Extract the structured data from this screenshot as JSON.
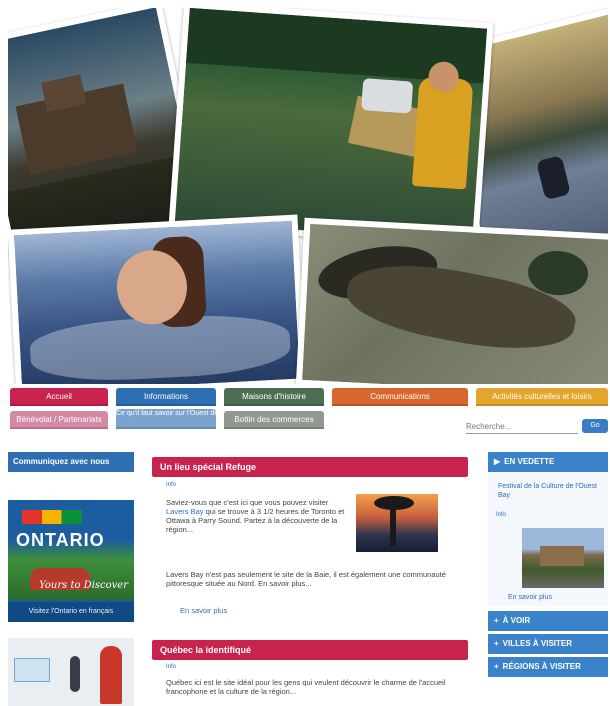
{
  "nav": {
    "row1": [
      {
        "label": "Accueil",
        "color": "#c8234d"
      },
      {
        "label": "Informations",
        "color": "#2d6fb2"
      },
      {
        "label": "Maisons d'histoire",
        "color": "#4e6e54"
      },
      {
        "label": "Communications",
        "color": "#d9662c"
      },
      {
        "label": "Activités culturelles et loisirs",
        "color": "#e3a52b"
      }
    ],
    "row2": [
      {
        "label": "Bénévolat / Partenariats",
        "color": "#d48aa4"
      },
      {
        "label": "Ce qu'il faut savoir sur l'Ouest de l'Ontario",
        "color": "#7aa4cf"
      },
      {
        "label": "Bottin des commerces",
        "color": "#8e9a8f"
      }
    ]
  },
  "search": {
    "placeholder": "Recherche...",
    "button": "Go"
  },
  "left": {
    "header": "Communiquez avec nous",
    "ad_logo": "ONTARIO",
    "ad_script": "Yours to Discover",
    "ad_caption": "Visitez l'Ontario en français"
  },
  "main": {
    "section1": {
      "title": "Un lieu spécial Refuge",
      "tag": "Info",
      "para1_a": "Saviez-vous que c'est ici que vous pouvez visiter",
      "para1_link": "Lavers Bay",
      "para1_b": "qui se trouve à 3 1/2 heures de Toronto et Ottawa à Parry Sound. Partez à la découverte de la région...",
      "para2": "Lavers Bay n'est pas seulement le site de la Baie, il est également une communauté pittoresque située au Nord. En savoir plus...",
      "more": "En savoir plus"
    },
    "section2": {
      "title": "Québec la identifiqué",
      "tag": "Info",
      "para": "Québec ici est le site idéal pour les gens qui veulent découvrir le charme de l'accueil francophone et la culture de la région..."
    }
  },
  "right": {
    "head1": "EN VEDETTE",
    "text": "Festival de la Culture de l'Ouest Bay",
    "tag": "Info",
    "more": "En savoir plus",
    "head2": "À VOIR",
    "head3": "VILLES À VISITER",
    "head4": "RÉGIONS À VISITER"
  }
}
